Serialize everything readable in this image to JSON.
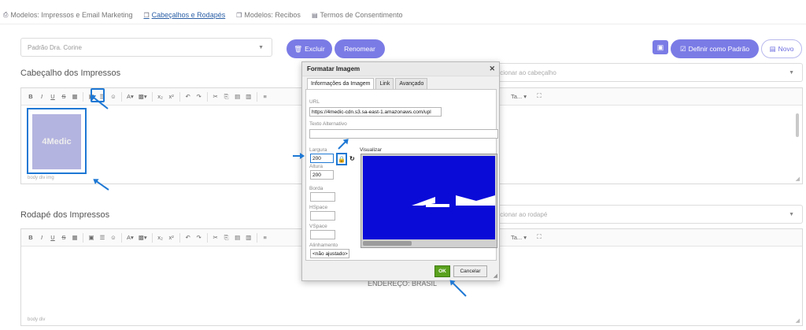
{
  "tabs": [
    {
      "label": "Modelos: Impressos e Email Marketing",
      "icon": "print-icon"
    },
    {
      "label": "Cabeçalhos e Rodapés",
      "icon": "copy-icon"
    },
    {
      "label": "Modelos: Recibos",
      "icon": "copy-icon"
    },
    {
      "label": "Termos de Consentimento",
      "icon": "document-icon"
    }
  ],
  "model_select": {
    "value": "Padrão Dra. Corine"
  },
  "buttons": {
    "excluir": "Excluir",
    "renomear": "Renomear",
    "definir_padrao": "Definir como Padrão",
    "novo": "Novo"
  },
  "header_section": {
    "title": "Cabeçalho dos Impressos",
    "select_placeholder": "dicionar ao cabeçalho",
    "statusbar": "body  div  img",
    "logo_text": "4Medic"
  },
  "footer_section": {
    "title": "Rodapé dos Impressos",
    "select_placeholder": "dicionar ao rodapé",
    "statusbar": "body  div",
    "body_text": "ENDEREÇO: BRASIL"
  },
  "toolbar": {
    "font_size": "Ta..."
  },
  "dialog": {
    "title": "Formatar Imagem",
    "tabs": [
      "Informações da Imagem",
      "Link",
      "Avançado"
    ],
    "url_label": "URL",
    "url_value": "https://4medic-cdn.s3.sa-east-1.amazonaws.com/upl",
    "alt_label": "Texto Alternativo",
    "width_label": "Largura",
    "width_value": "200",
    "height_label": "Altura",
    "height_value": "200",
    "preview_label": "Visualizar",
    "border_label": "Borda",
    "hspace_label": "HSpace",
    "vspace_label": "VSpace",
    "align_label": "Alinhamento",
    "align_value": "<não ajustado>",
    "ok": "OK",
    "cancel": "Cancelar"
  },
  "colors": {
    "accent": "#7b7be6",
    "highlight": "#1e78d4",
    "ok_green": "#5aa11e",
    "preview_blue": "#0b0bd8"
  }
}
